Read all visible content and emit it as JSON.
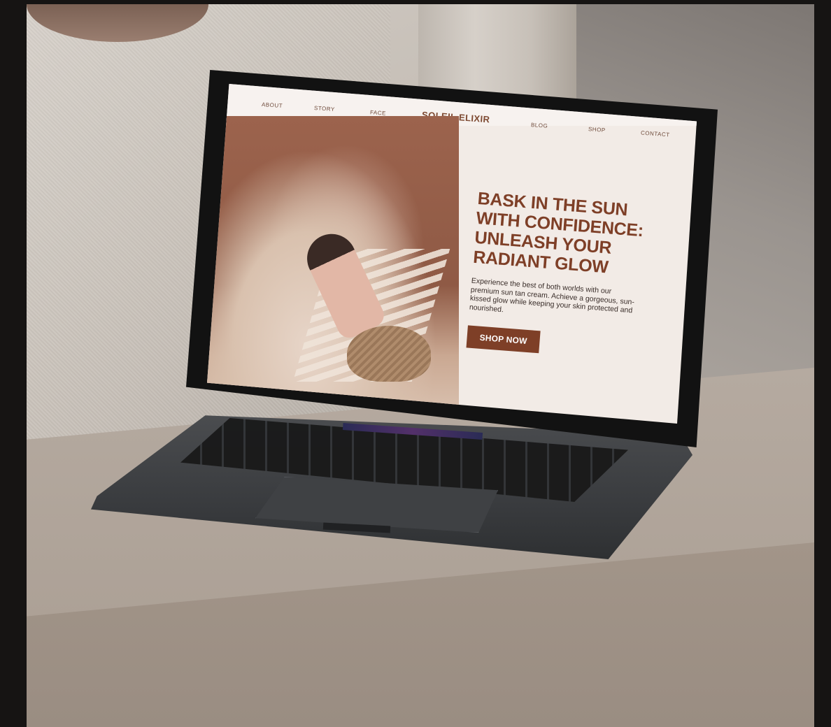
{
  "nav": {
    "items": [
      "ABOUT",
      "STORY",
      "FACE",
      "BLOG",
      "SHOP",
      "CONTACT"
    ],
    "brand": "SOLEIL ELIXIR"
  },
  "hero": {
    "headline_lines": [
      "BASK IN THE SUN",
      "WITH CONFIDENCE:",
      "UNLEASH YOUR",
      "RADIANT GLOW"
    ],
    "body": "Experience the best of both worlds with our premium sun tan cream. Achieve a gorgeous, sun-kissed glow while keeping your skin protected and nourished.",
    "cta": "SHOP NOW"
  },
  "colors": {
    "accent": "#7e3f27",
    "screen_bg": "#f2ebe6"
  }
}
